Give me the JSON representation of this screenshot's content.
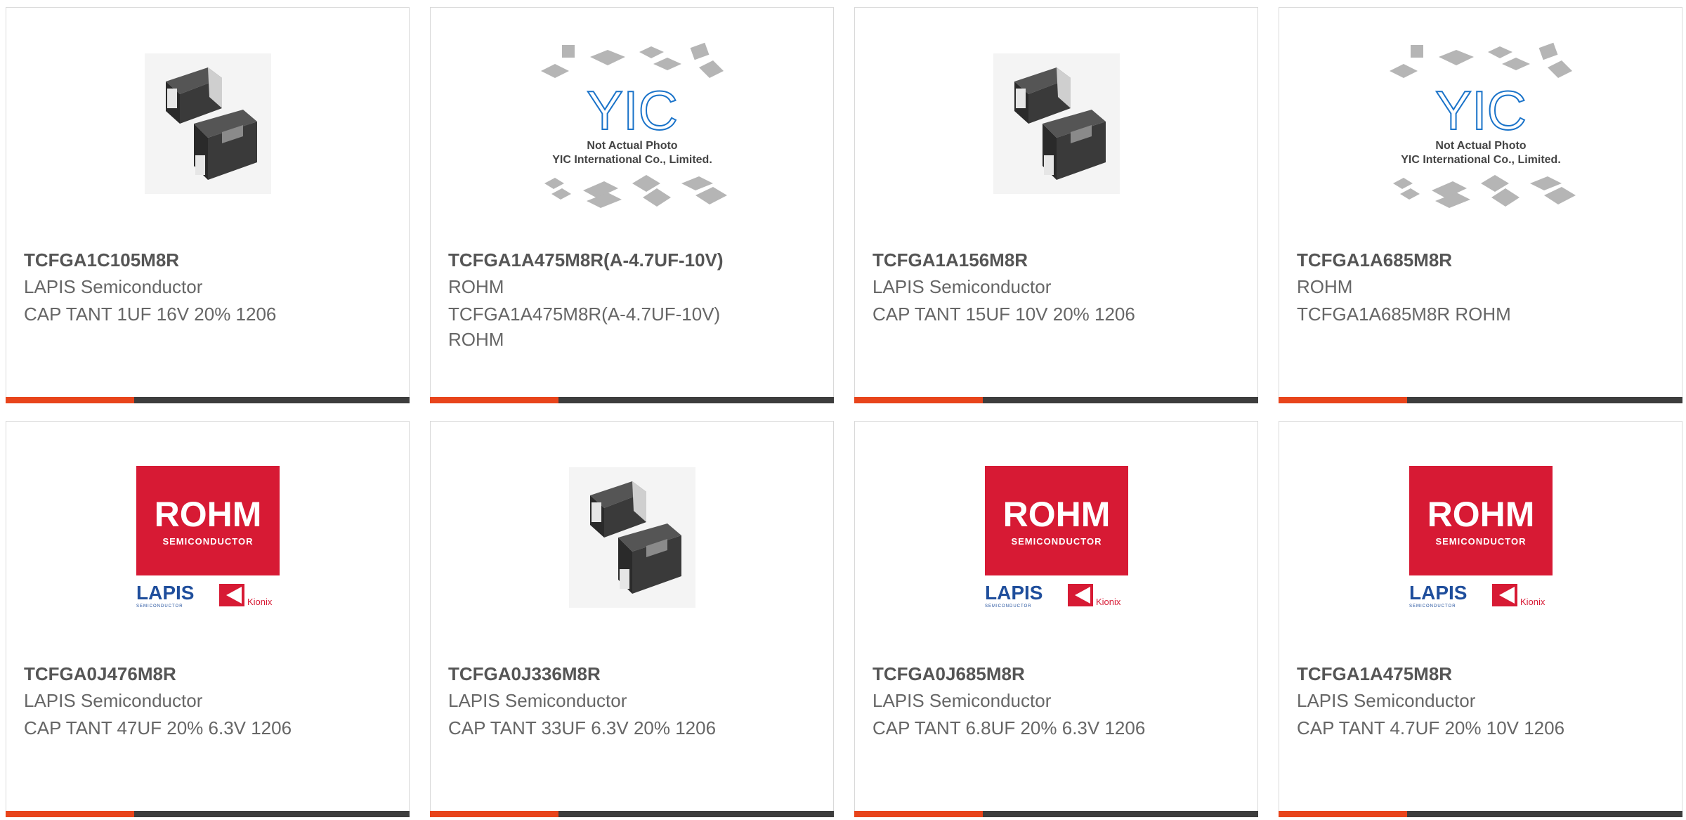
{
  "colors": {
    "accent": "#e8441b",
    "bar": "#3d3d3d",
    "rohm_red": "#d71a34",
    "lapis_blue": "#1f4e9c",
    "yic_blue": "#1a73c9"
  },
  "images": {
    "yic": {
      "line1": "Not Actual Photo",
      "line2": "YIC International Co., Limited.",
      "logo": "YIC"
    },
    "rohm": {
      "brand": "ROHM",
      "sub": "SEMICONDUCTOR",
      "lapis": "LAPIS",
      "lapis_sub": "SEMICONDUCTOR",
      "kionix": "Kionix"
    }
  },
  "products": [
    {
      "image": "capacitor-photo",
      "part": "TCFGA1C105M8R",
      "maker": "LAPIS Semiconductor",
      "desc": "CAP TANT 1UF 16V 20% 1206"
    },
    {
      "image": "yic-placeholder",
      "part": "TCFGA1A475M8R(A-4.7UF-10V)",
      "maker": "ROHM",
      "desc": "TCFGA1A475M8R(A-4.7UF-10V) ROHM"
    },
    {
      "image": "capacitor-photo",
      "part": "TCFGA1A156M8R",
      "maker": "LAPIS Semiconductor",
      "desc": "CAP TANT 15UF 10V 20% 1206"
    },
    {
      "image": "yic-placeholder",
      "part": "TCFGA1A685M8R",
      "maker": "ROHM",
      "desc": "TCFGA1A685M8R ROHM"
    },
    {
      "image": "rohm-logo",
      "part": "TCFGA0J476M8R",
      "maker": "LAPIS Semiconductor",
      "desc": "CAP TANT 47UF 20% 6.3V 1206"
    },
    {
      "image": "capacitor-photo",
      "part": "TCFGA0J336M8R",
      "maker": "LAPIS Semiconductor",
      "desc": "CAP TANT 33UF 6.3V 20% 1206"
    },
    {
      "image": "rohm-logo",
      "part": "TCFGA0J685M8R",
      "maker": "LAPIS Semiconductor",
      "desc": "CAP TANT 6.8UF 20% 6.3V 1206"
    },
    {
      "image": "rohm-logo",
      "part": "TCFGA1A475M8R",
      "maker": "LAPIS Semiconductor",
      "desc": "CAP TANT 4.7UF 20% 10V 1206"
    }
  ]
}
